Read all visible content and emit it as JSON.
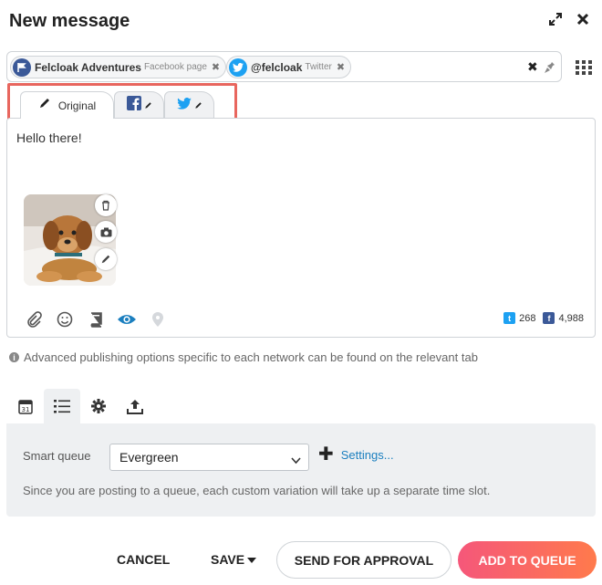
{
  "header": {
    "title": "New message",
    "expand_icon": "expand-icon",
    "close_icon": "close-icon"
  },
  "profiles": [
    {
      "name": "Felcloak Adventures",
      "type": "Facebook page",
      "color": "#3b5998",
      "icon": "flag-icon"
    },
    {
      "name": "@felcloak",
      "type": "Twitter",
      "color": "#1da1f2",
      "icon": "twitter-icon"
    }
  ],
  "tabs": [
    {
      "label": "Original",
      "icon": "pencil-icon"
    },
    {
      "label": "",
      "icon": "facebook-edit-icon"
    },
    {
      "label": "",
      "icon": "twitter-edit-icon"
    }
  ],
  "composer": {
    "text": "Hello there!",
    "counts": {
      "twitter": "268",
      "facebook": "4,988"
    }
  },
  "hint": "Advanced publishing options specific to each network can be found on the relevant tab",
  "scheduling": {
    "tabs": [
      "calendar-icon",
      "list-icon",
      "gear-icon",
      "upload-icon"
    ],
    "active_tab": 1,
    "queue_label": "Smart queue",
    "queue_value": "Evergreen",
    "settings_label": "Settings...",
    "note": "Since you are posting to a queue, each custom variation will take up a separate time slot."
  },
  "footer": {
    "cancel": "CANCEL",
    "save": "SAVE",
    "approval": "SEND FOR APPROVAL",
    "add_to_queue": "ADD TO QUEUE"
  },
  "colors": {
    "accent": "#1b7fbf",
    "highlight_border": "#e8665e",
    "primary_start": "#f5577a",
    "primary_end": "#ff7a4c"
  }
}
